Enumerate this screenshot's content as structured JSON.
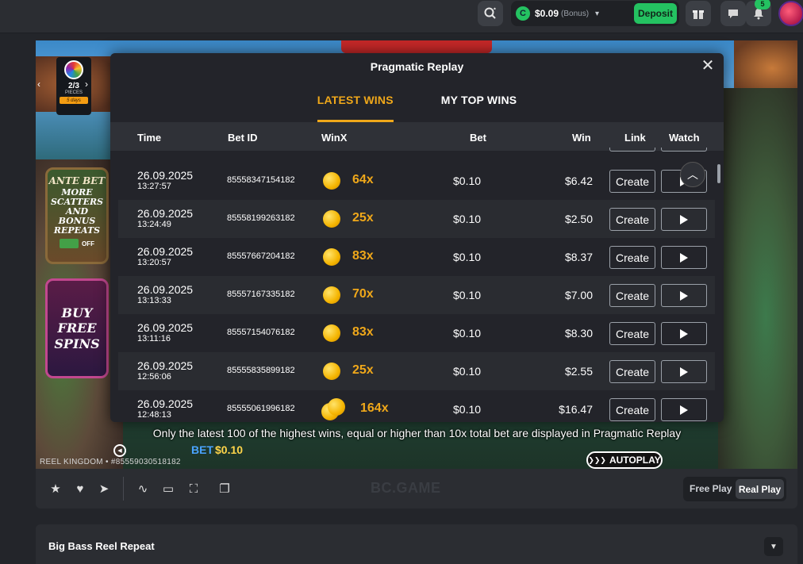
{
  "header": {
    "balance": "$0.09",
    "balance_tag": "(Bonus)",
    "deposit_label": "Deposit",
    "notifications_count": "5",
    "coin_glyph": "C"
  },
  "game": {
    "feature": {
      "progress": "2/3",
      "pieces_label": "PIECES",
      "days_label": "5 days"
    },
    "ante_bet": {
      "title": "ANTE BET",
      "text": "MORE SCATTERS AND BONUS REPEATS",
      "toggle": "OFF"
    },
    "buy_free_spins": "BUY FREE SPINS",
    "bet_label": "BET",
    "bet_value": "$0.10",
    "autoplay_label": "AUTOPLAY",
    "footer_text": "REEL KINGDOM • #85559030518182"
  },
  "modal": {
    "title": "Pragmatic Replay",
    "tabs": [
      {
        "label": "LATEST WINS",
        "active": true
      },
      {
        "label": "MY TOP WINS",
        "active": false
      }
    ],
    "columns": {
      "time": "Time",
      "bet_id": "Bet ID",
      "winx": "WinX",
      "bet": "Bet",
      "win": "Win",
      "link": "Link",
      "watch": "Watch"
    },
    "create_label": "Create",
    "rows": [
      {
        "date": "26.09.2025",
        "time": "13:27:57",
        "bet_id": "85558347154182",
        "winx": "64x",
        "bet": "$0.10",
        "win": "$6.42"
      },
      {
        "date": "26.09.2025",
        "time": "13:24:49",
        "bet_id": "85558199263182",
        "winx": "25x",
        "bet": "$0.10",
        "win": "$2.50"
      },
      {
        "date": "26.09.2025",
        "time": "13:20:57",
        "bet_id": "85557667204182",
        "winx": "83x",
        "bet": "$0.10",
        "win": "$8.37"
      },
      {
        "date": "26.09.2025",
        "time": "13:13:33",
        "bet_id": "85557167335182",
        "winx": "70x",
        "bet": "$0.10",
        "win": "$7.00"
      },
      {
        "date": "26.09.2025",
        "time": "13:11:16",
        "bet_id": "85557154076182",
        "winx": "83x",
        "bet": "$0.10",
        "win": "$8.30"
      },
      {
        "date": "26.09.2025",
        "time": "12:56:06",
        "bet_id": "85555835899182",
        "winx": "25x",
        "bet": "$0.10",
        "win": "$2.55"
      },
      {
        "date": "26.09.2025",
        "time": "12:48:13",
        "bet_id": "85555061996182",
        "winx": "164x",
        "bet": "$0.10",
        "win": "$16.47"
      }
    ],
    "notice": "Only the latest 100 of the highest wins, equal or higher than 10x total bet are displayed in Pragmatic Replay"
  },
  "toolbar": {
    "brand": "BC.GAME",
    "free_play": "Free Play",
    "real_play": "Real Play"
  },
  "info": {
    "game_title": "Big Bass Reel Repeat"
  },
  "colors": {
    "accent": "#f0a81a",
    "green": "#24c261",
    "background": "#23252a"
  }
}
